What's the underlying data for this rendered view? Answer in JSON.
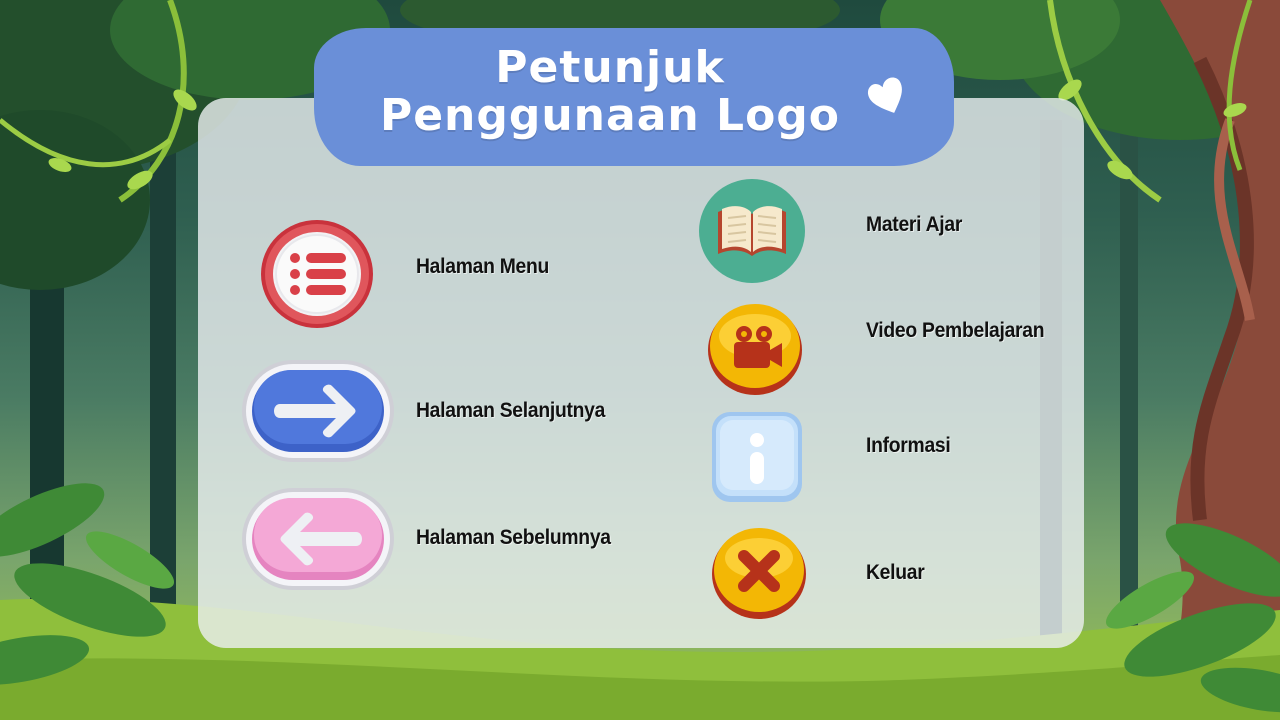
{
  "title": {
    "line1": "Petunjuk",
    "line2": "Penggunaan Logo"
  },
  "legend": {
    "left": [
      {
        "icon": "menu-list-icon",
        "label": "Halaman Menu"
      },
      {
        "icon": "arrow-right-icon",
        "label": "Halaman Selanjutnya"
      },
      {
        "icon": "arrow-left-icon",
        "label": "Halaman Sebelumnya"
      }
    ],
    "right": [
      {
        "icon": "open-book-icon",
        "label": "Materi Ajar"
      },
      {
        "icon": "video-camera-icon",
        "label": "Video Pembelajaran"
      },
      {
        "icon": "info-icon",
        "label": "Informasi"
      },
      {
        "icon": "close-x-icon",
        "label": "Keluar"
      }
    ]
  },
  "colors": {
    "banner": "#6a8fd8",
    "menu_icon": "#d9434a",
    "next_button": "#4c72d6",
    "prev_button": "#f2a3d3",
    "book_circle": "#4cae92",
    "gold_button": "#f2b705",
    "info_button": "#b9d8f5"
  }
}
